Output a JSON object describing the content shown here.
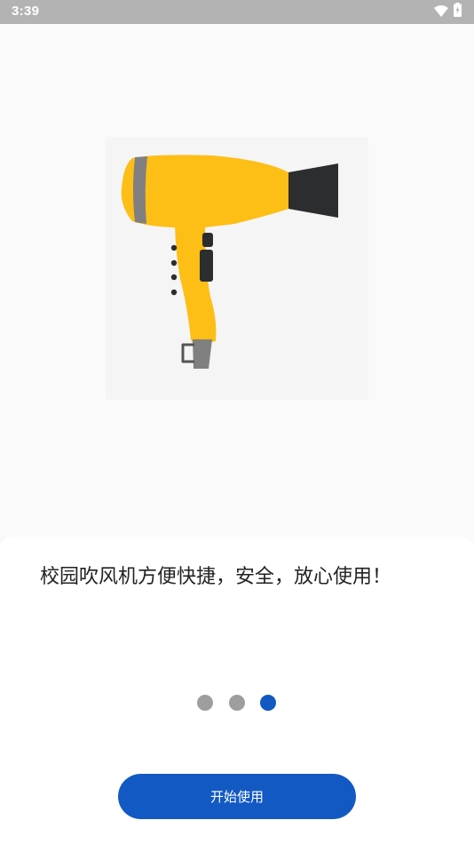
{
  "status_bar": {
    "time": "3:39",
    "icons": [
      "wifi-icon",
      "battery-charging-icon"
    ]
  },
  "illustration": {
    "icon": "hair-dryer-icon",
    "colors": {
      "body": "#fdbe16",
      "nozzle": "#2b2d2f",
      "band": "#808080",
      "buttons": "#2b2d2f",
      "background": "#f5f5f5"
    }
  },
  "onboarding": {
    "slogan": "校园吹风机方便快捷，安全，放心使用！",
    "page_count": 3,
    "current_page": 3,
    "start_button_label": "开始使用"
  },
  "colors": {
    "accent": "#1259c3",
    "dot_inactive": "#9e9e9e",
    "status_bar": "#b3b3b3"
  }
}
